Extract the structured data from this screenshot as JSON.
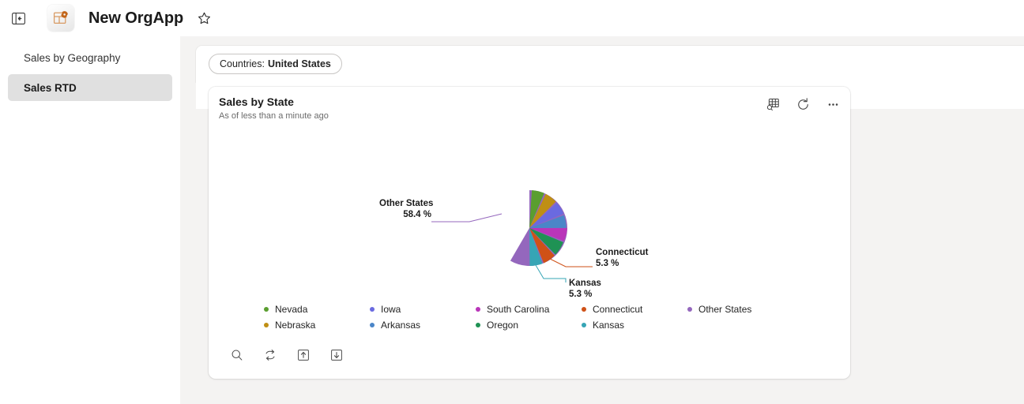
{
  "topbar": {
    "collapse_icon": "panel-collapse-icon",
    "app_icon": "table-app-icon",
    "title": "New OrgApp",
    "favorite_icon": "star-outline-icon"
  },
  "sidebar": {
    "items": [
      {
        "label": "Sales by Geography",
        "selected": false
      },
      {
        "label": "Sales RTD",
        "selected": true
      }
    ]
  },
  "filter_bar": {
    "pill": {
      "key": "Countries:",
      "value": "United States"
    }
  },
  "card": {
    "title": "Sales by State",
    "subtitle": "As of less than a minute ago",
    "actions": [
      {
        "name": "table-search-icon",
        "label": "View data"
      },
      {
        "name": "refresh-icon",
        "label": "Refresh"
      },
      {
        "name": "more-options-icon",
        "label": "More options"
      }
    ],
    "tools": [
      {
        "name": "search-icon",
        "label": "Search"
      },
      {
        "name": "sync-icon",
        "label": "Sync"
      },
      {
        "name": "upload-icon",
        "label": "Upload"
      },
      {
        "name": "download-icon",
        "label": "Download"
      }
    ]
  },
  "chart_data": {
    "type": "pie",
    "title": "Sales by State",
    "subtitle": "As of less than a minute ago",
    "legend_position": "bottom",
    "grid": false,
    "value_suffix": " %",
    "categories": [
      "Other States",
      "Nevada",
      "Nebraska",
      "Iowa",
      "Arkansas",
      "South Carolina",
      "Oregon",
      "Connecticut",
      "Kansas"
    ],
    "values": [
      58.4,
      5.3,
      5.3,
      5.3,
      5.3,
      5.3,
      5.3,
      5.3,
      5.3
    ],
    "colors": [
      "#9467bd",
      "#5a9e2f",
      "#bf8f14",
      "#6a6ae0",
      "#4a86c8",
      "#b935b9",
      "#1f9254",
      "#cf5117",
      "#36a5b5"
    ],
    "labeled_slices": [
      {
        "name": "Other States",
        "pct": "58.4 %"
      },
      {
        "name": "Connecticut",
        "pct": "5.3 %"
      },
      {
        "name": "Kansas",
        "pct": "5.3 %"
      }
    ],
    "legend": [
      {
        "label": "Nevada",
        "color": "#5a9e2f"
      },
      {
        "label": "Iowa",
        "color": "#6a6ae0"
      },
      {
        "label": "South Carolina",
        "color": "#b935b9"
      },
      {
        "label": "Connecticut",
        "color": "#cf5117"
      },
      {
        "label": "Other States",
        "color": "#9467bd"
      },
      {
        "label": "Nebraska",
        "color": "#bf8f14"
      },
      {
        "label": "Arkansas",
        "color": "#4a86c8"
      },
      {
        "label": "Oregon",
        "color": "#1f9254"
      },
      {
        "label": "Kansas",
        "color": "#36a5b5"
      }
    ]
  },
  "labels": {
    "other_states_name": "Other States",
    "other_states_pct": "58.4 %",
    "connecticut_name": "Connecticut",
    "connecticut_pct": "5.3 %",
    "kansas_name": "Kansas",
    "kansas_pct": "5.3 %"
  }
}
